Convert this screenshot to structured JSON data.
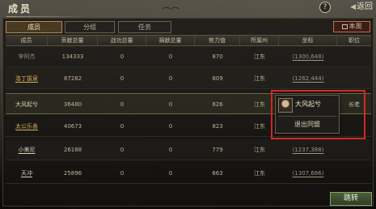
{
  "header": {
    "title": "成员",
    "help_label": "?",
    "back_label": "返回"
  },
  "tabs": [
    {
      "label": "成员",
      "active": true
    },
    {
      "label": "分组",
      "active": false
    },
    {
      "label": "任务",
      "active": false
    }
  ],
  "control_button_label": "本周",
  "table": {
    "columns": [
      "成员",
      "贡献总量",
      "战功总量",
      "捐献总量",
      "势力值",
      "所属州",
      "坐标",
      "职位"
    ],
    "rows": [
      {
        "name": "李阿杰",
        "contribution": "134333",
        "merit": "0",
        "donation": "0",
        "power": "870",
        "state": "江东",
        "coord": "(1300,648)",
        "job": ""
      },
      {
        "name": "洛丁拔泉",
        "contribution": "87282",
        "merit": "0",
        "donation": "0",
        "power": "809",
        "state": "江东",
        "coord": "(1262,444)",
        "job": ""
      },
      {
        "name": "大风起兮",
        "contribution": "36480",
        "merit": "0",
        "donation": "0",
        "power": "826",
        "state": "江东",
        "coord": "",
        "job": "长老"
      },
      {
        "name": "太公乐善",
        "contribution": "40673",
        "merit": "0",
        "donation": "0",
        "power": "823",
        "state": "江东",
        "coord": "",
        "job": ""
      },
      {
        "name": "小美尼",
        "contribution": "26188",
        "merit": "0",
        "donation": "0",
        "power": "779",
        "state": "江东",
        "coord": "(1237,388)",
        "job": ""
      },
      {
        "name": "天冲",
        "contribution": "25896",
        "merit": "0",
        "donation": "0",
        "power": "663",
        "state": "江东",
        "coord": "(1307,686)",
        "job": ""
      }
    ]
  },
  "popup": {
    "name": "大风起兮",
    "leave_label": "退出同盟"
  },
  "jump_label": "跳转",
  "colors": {
    "accent_red": "#d32a22",
    "gold_name": "#d7b05a",
    "jump_green": "#4b5e3a"
  }
}
